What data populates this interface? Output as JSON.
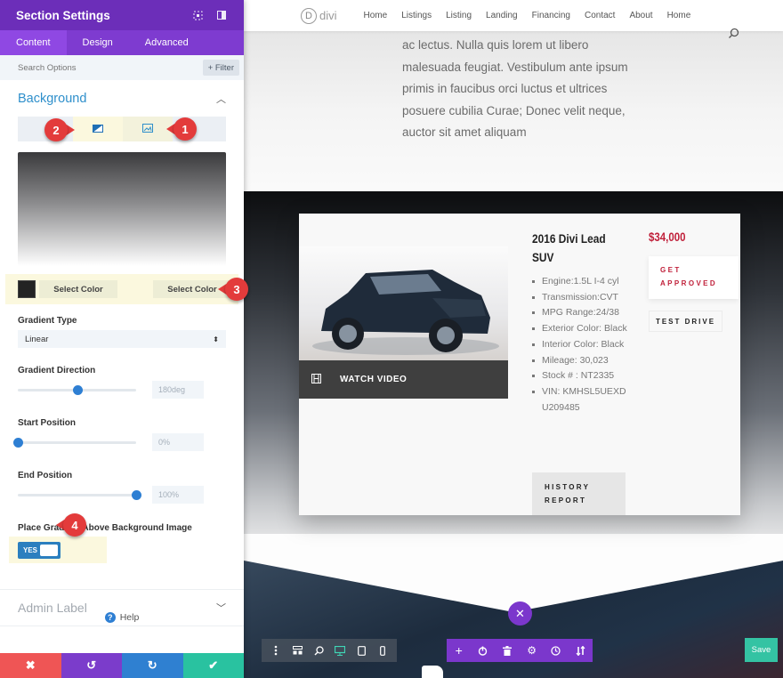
{
  "panel": {
    "title": "Section Settings",
    "header_icons": [
      "expand-icon",
      "sidebar-toggle-icon"
    ],
    "tabs": [
      {
        "label": "Content",
        "active": true
      },
      {
        "label": "Design",
        "active": false
      },
      {
        "label": "Advanced",
        "active": false
      }
    ],
    "search": {
      "placeholder": "Search Options",
      "filter_label": "+ Filter"
    },
    "background": {
      "section_label": "Background",
      "bg_type_tabs": [
        "gradient-icon",
        "image-icon"
      ],
      "color_stops": {
        "start_label": "Select Color",
        "end_label": "Select Color",
        "start_swatch_color": "#232323"
      },
      "gradient_type": {
        "label": "Gradient Type",
        "value": "Linear"
      },
      "gradient_direction": {
        "label": "Gradient Direction",
        "value": "180deg",
        "slider_fraction": 0.5
      },
      "start_position": {
        "label": "Start Position",
        "value": "0%",
        "slider_fraction": 0.0
      },
      "end_position": {
        "label": "End Position",
        "value": "100%",
        "slider_fraction": 1.0
      },
      "gradient_above": {
        "label": "Place Gradient Above Background Image",
        "toggle_label": "YES",
        "on": true
      }
    },
    "admin_label": "Admin Label",
    "help_label": "Help",
    "footer": [
      {
        "name": "discard",
        "glyph": "✖",
        "color": "#ef5555"
      },
      {
        "name": "undo",
        "glyph": "↺",
        "color": "#7b3ccb"
      },
      {
        "name": "redo",
        "glyph": "↻",
        "color": "#2f80d1"
      },
      {
        "name": "save",
        "glyph": "✔",
        "color": "#29c2a0"
      }
    ]
  },
  "markers": [
    "1",
    "2",
    "3",
    "4"
  ],
  "site": {
    "logo_letter": "D",
    "logo_text": "divi",
    "nav": [
      "Home",
      "Listings",
      "Listing",
      "Landing",
      "Financing",
      "Contact",
      "About",
      "Home"
    ],
    "hero_text": "ac lectus. Nulla quis lorem ut libero malesuada feugiat. Vestibulum ante ipsum primis in faucibus orci luctus et ultrices posuere cubilia Curae; Donec velit neque, auctor sit amet aliquam",
    "listing": {
      "title": "2016 Divi Lead SUV",
      "price": "$34,000",
      "watch_video": "WATCH VIDEO",
      "specs": [
        "Engine:1.5L I-4 cyl",
        "Transmission:CVT",
        "MPG Range:24/38",
        "Exterior Color: Black",
        "Interior Color: Black",
        "Mileage: 30,023",
        "Stock # : NT2335",
        "VIN: KMHSL5UEXDU209485"
      ],
      "history_line1": "HISTORY",
      "history_line2": "REPORT",
      "get_line1": "GET",
      "get_line2": "APPROVED",
      "test_drive": "TEST DRIVE"
    }
  },
  "builder": {
    "left_tools": [
      "menu-dots-icon",
      "wireframe-icon",
      "zoom-icon",
      "desktop-icon",
      "tablet-icon",
      "phone-icon"
    ],
    "right_tools": [
      "add-icon",
      "power-icon",
      "trash-icon",
      "gear-icon",
      "history-icon",
      "sort-icon"
    ],
    "save_label": "Save"
  }
}
